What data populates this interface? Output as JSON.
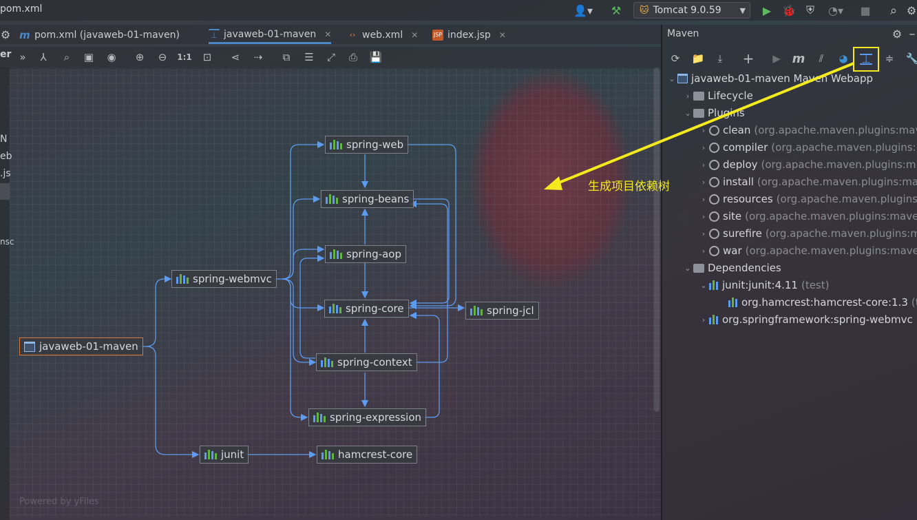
{
  "titlebar": {
    "file": "pom.xml",
    "run_config": "Tomcat 9.0.59"
  },
  "tabs": [
    {
      "label": "pom.xml (javaweb-01-maven)",
      "icon": "maven-m-icon"
    },
    {
      "label": "javaweb-01-maven",
      "icon": "diagram-icon"
    },
    {
      "label": "web.xml",
      "icon": "xml-file-icon"
    },
    {
      "label": "index.jsp",
      "icon": "jsp-file-icon"
    }
  ],
  "left_strip": {
    "t1": "er",
    "t2": "N",
    "t3": "eb",
    "t4": ".js",
    "t5": "nsc"
  },
  "diagram": {
    "nodes": {
      "root": "javaweb-01-maven",
      "webmvc": "spring-webmvc",
      "web": "spring-web",
      "beans": "spring-beans",
      "aop": "spring-aop",
      "core": "spring-core",
      "jcl": "spring-jcl",
      "context": "spring-context",
      "expression": "spring-expression",
      "junit": "junit",
      "hamcrest": "hamcrest-core"
    },
    "watermark": "Powered by yFiles"
  },
  "annotation": "生成项目依赖树",
  "maven": {
    "title": "Maven",
    "project": "javaweb-01-maven Maven Webapp",
    "lifecycle": "Lifecycle",
    "plugins_label": "Plugins",
    "plugins": [
      {
        "name": "clean",
        "group": "(org.apache.maven.plugins:mav"
      },
      {
        "name": "compiler",
        "group": "(org.apache.maven.plugins:m"
      },
      {
        "name": "deploy",
        "group": "(org.apache.maven.plugins:m"
      },
      {
        "name": "install",
        "group": "(org.apache.maven.plugins:mav"
      },
      {
        "name": "resources",
        "group": "(org.apache.maven.plugins"
      },
      {
        "name": "site",
        "group": "(org.apache.maven.plugins:maven"
      },
      {
        "name": "surefire",
        "group": "(org.apache.maven.plugins:m"
      },
      {
        "name": "war",
        "group": "(org.apache.maven.plugins:maven"
      }
    ],
    "dependencies_label": "Dependencies",
    "dep_junit": "junit:junit:4.11",
    "dep_junit_scope": "(test)",
    "dep_hamcrest": "org.hamcrest:hamcrest-core:1.3",
    "dep_hamcrest_scope": "(t",
    "dep_spring": "org.springframework:spring-webmvc"
  },
  "colors": {
    "accent": "#4a88c7",
    "edge": "#5b9bf0",
    "annotation": "#f4ea1e",
    "root_border": "#d97a3b"
  }
}
